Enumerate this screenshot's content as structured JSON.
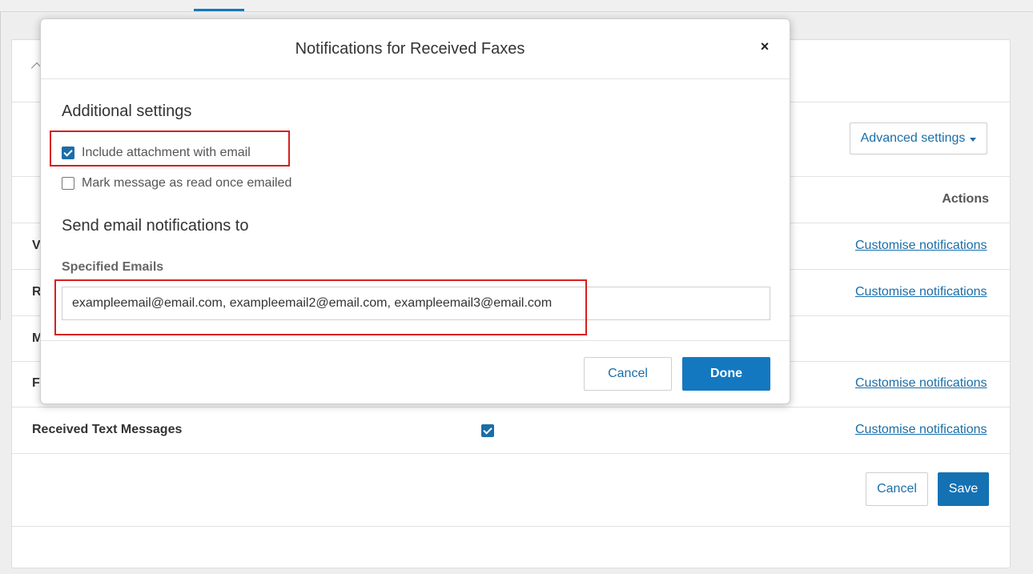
{
  "background": {
    "advanced_settings_label": "Advanced settings",
    "actions_header": "Actions",
    "rows": [
      {
        "label": "V",
        "link": "Customise notifications"
      },
      {
        "label": "R",
        "link": "Customise notifications"
      },
      {
        "label": "M",
        "link": ""
      },
      {
        "label": "F",
        "link": "Customise notifications"
      },
      {
        "label": "Received Text Messages",
        "link": "Customise notifications",
        "checked": true
      }
    ],
    "cancel_label": "Cancel",
    "save_label": "Save"
  },
  "modal": {
    "title": "Notifications for Received Faxes",
    "close_glyph": "×",
    "additional_settings_heading": "Additional settings",
    "include_attachment": {
      "label": "Include attachment with email",
      "checked": true
    },
    "mark_as_read": {
      "label": "Mark message as read once emailed",
      "checked": false
    },
    "send_to_heading": "Send email notifications to",
    "specified_emails_label": "Specified Emails",
    "specified_emails_value": "exampleemail@email.com, exampleemail2@email.com, exampleemail3@email.com",
    "cancel_label": "Cancel",
    "done_label": "Done"
  },
  "colors": {
    "accent": "#1478c0",
    "link": "#1a6ea8",
    "highlight": "#d81e1e"
  }
}
